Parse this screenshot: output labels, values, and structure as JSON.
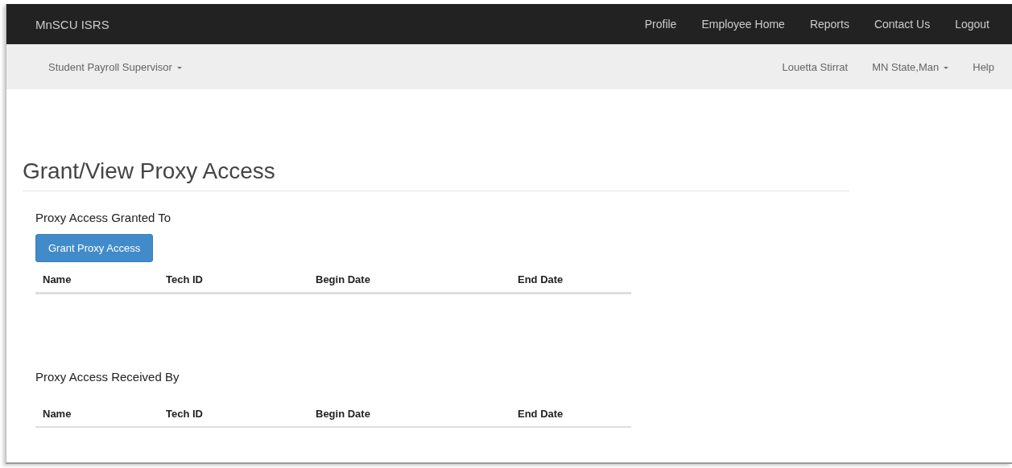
{
  "navbar": {
    "brand": "MnSCU ISRS",
    "links": [
      "Profile",
      "Employee Home",
      "Reports",
      "Contact Us",
      "Logout"
    ]
  },
  "subnav": {
    "left": [
      {
        "label": "Student Payroll Supervisor",
        "kind": "dropdown"
      }
    ],
    "right": [
      {
        "label": "Louetta Stirrat",
        "kind": "text"
      },
      {
        "label": "MN State,Man",
        "kind": "dropdown"
      },
      {
        "label": "Help",
        "kind": "link"
      }
    ]
  },
  "page_title": "Grant/View Proxy Access",
  "sections": [
    {
      "title": "Proxy Access Granted To",
      "button": "Grant Proxy Access",
      "columns": [
        "Name",
        "Tech ID",
        "Begin Date",
        "End Date"
      ]
    },
    {
      "title": "Proxy Access Received By",
      "columns": [
        "Name",
        "Tech ID",
        "Begin Date",
        "End Date"
      ]
    }
  ]
}
